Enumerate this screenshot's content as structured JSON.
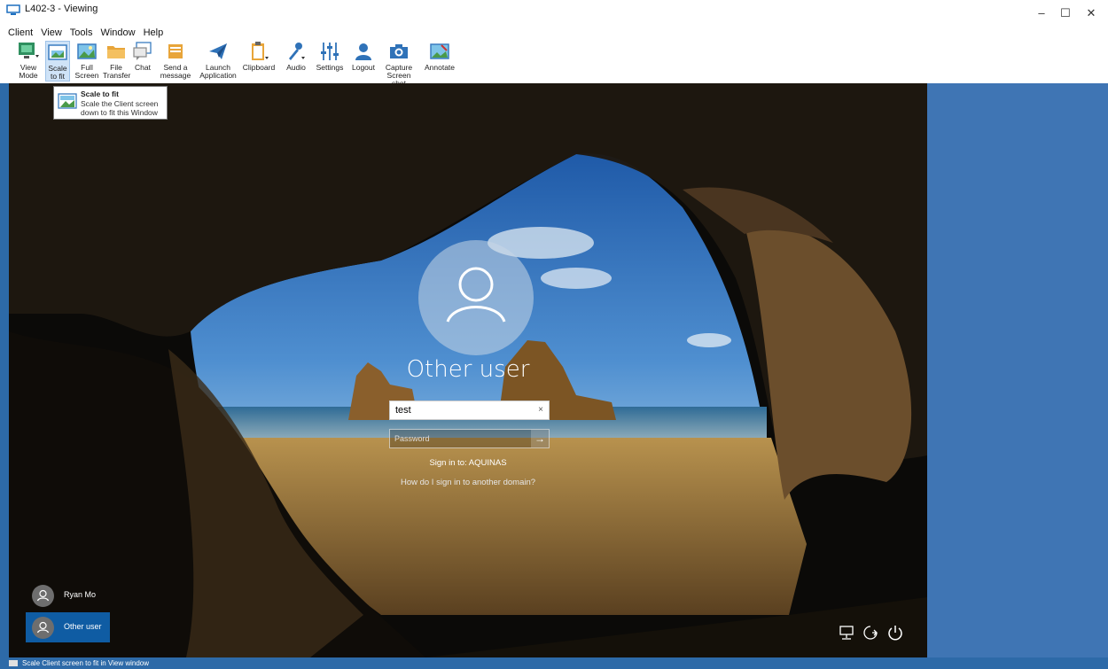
{
  "window": {
    "title": "L402-3 - Viewing",
    "minimize": "–",
    "maximize": "☐",
    "close": "✕"
  },
  "menu": [
    "Client",
    "View",
    "Tools",
    "Window",
    "Help"
  ],
  "toolbar": [
    {
      "icon": "view-mode-icon",
      "label1": "View",
      "label2": "Mode"
    },
    {
      "icon": "scale-to-fit-icon",
      "label1": "Scale",
      "label2": "to fit"
    },
    {
      "icon": "full-screen-icon",
      "label1": "Full",
      "label2": "Screen"
    },
    {
      "icon": "file-transfer-icon",
      "label1": "File",
      "label2": "Transfer"
    },
    {
      "icon": "chat-icon",
      "label1": "Chat",
      "label2": ""
    },
    {
      "icon": "send-message-icon",
      "label1": "Send a",
      "label2": "message"
    },
    {
      "icon": "launch-application-icon",
      "label1": "Launch",
      "label2": "Application"
    },
    {
      "icon": "clipboard-icon",
      "label1": "Clipboard",
      "label2": ""
    },
    {
      "icon": "audio-icon",
      "label1": "Audio",
      "label2": ""
    },
    {
      "icon": "settings-icon",
      "label1": "Settings",
      "label2": ""
    },
    {
      "icon": "logout-icon",
      "label1": "Logout",
      "label2": ""
    },
    {
      "icon": "capture-screenshot-icon",
      "label1": "Capture",
      "label2": "Screen shot"
    },
    {
      "icon": "annotate-icon",
      "label1": "Annotate",
      "label2": ""
    }
  ],
  "tooltip": {
    "title": "Scale to fit",
    "description": "Scale the Client screen down to fit this Window"
  },
  "login": {
    "username": "Other user",
    "username_value": "test",
    "clear": "×",
    "password_placeholder": "Password",
    "submit": "→",
    "signin_domain": "Sign in to: AQUINAS",
    "other_domain_link": "How do I sign in to another domain?"
  },
  "users": [
    {
      "name": "Ryan Mo",
      "selected": false
    },
    {
      "name": "Other user",
      "selected": true
    }
  ],
  "statusbar": {
    "text": "Scale Client screen to fit in View window"
  },
  "colors": {
    "accent": "#0f5ca3",
    "workspace": "#3f75b4",
    "statusbar": "#2d6aa8"
  }
}
